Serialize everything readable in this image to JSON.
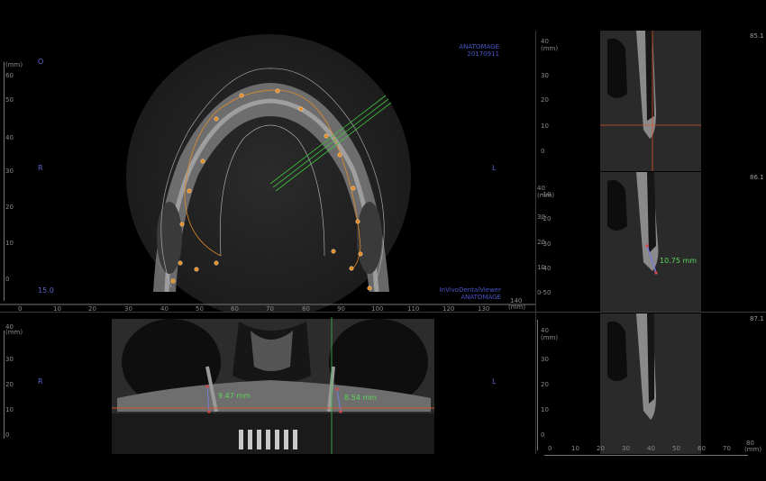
{
  "axial": {
    "logo_line1": "ANATOMAGE",
    "logo_line2": "20170911",
    "footer_line1": "InVivoDentalViewer",
    "footer_line2": "ANATOMAGE",
    "marker_top": "O",
    "marker_left": "R",
    "marker_right": "L",
    "slice_value": "15.0",
    "unit_label": "(mm)",
    "y_ticks": [
      "60",
      "50",
      "40",
      "30",
      "20",
      "10",
      "0"
    ],
    "right_ticks": [
      "40",
      "30",
      "20",
      "10",
      "0",
      "-10",
      "-20",
      "-30",
      "-40",
      "-50"
    ],
    "x_ticks": [
      "0",
      "10",
      "20",
      "30",
      "40",
      "50",
      "60",
      "70",
      "80",
      "90",
      "100",
      "110",
      "120",
      "130",
      "140"
    ]
  },
  "panoramic": {
    "marker_left": "R",
    "marker_right": "L",
    "measure_left": "9.47 mm",
    "measure_right": "8.54 mm",
    "unit_label": "(mm)",
    "y_ticks": [
      "40",
      "30",
      "20",
      "10",
      "0"
    ],
    "right_ticks": [
      "40",
      "30",
      "20",
      "10",
      "0"
    ]
  },
  "cross_sections": {
    "slices": [
      {
        "label": "85.1"
      },
      {
        "label": "86.1",
        "measure": "10.75 mm"
      },
      {
        "label": "87.1"
      }
    ],
    "unit_label": "(mm)",
    "x_ticks": [
      "0",
      "10",
      "20",
      "30",
      "40",
      "50",
      "60",
      "70",
      "80"
    ],
    "y_ticks": [
      "40",
      "30",
      "20",
      "10",
      "0"
    ]
  },
  "colors": {
    "logo": "#4a55c8",
    "measure": "#5cd65c",
    "guide_line": "#d4552a",
    "implant_line": "#3fbf3f"
  }
}
